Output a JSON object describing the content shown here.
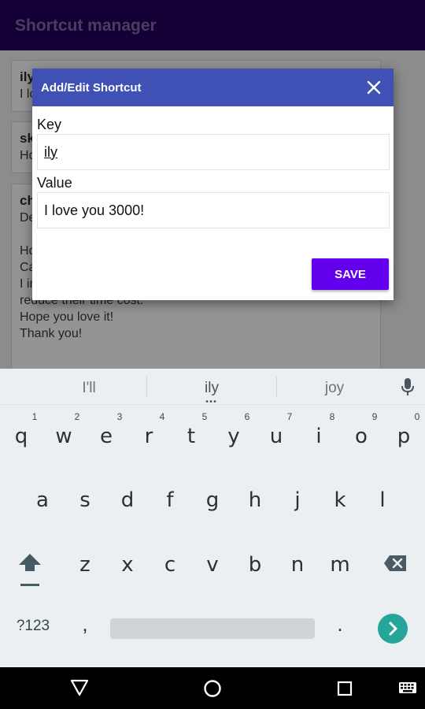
{
  "app": {
    "title": "Shortcut manager"
  },
  "background_cards": [
    {
      "title": "ily",
      "body": "I lo"
    },
    {
      "title": "sk",
      "body": "Ho"
    },
    {
      "title": "ch",
      "body": "De\n\nHo\nCa\nI intent to create an app ecosystem to make users\nreduce their time cost.\nHope you love it!\nThank you!"
    }
  ],
  "dialog": {
    "title": "Add/Edit Shortcut",
    "key_label": "Key",
    "key_value": "ily",
    "value_label": "Value",
    "value_value": "I love you 3000!",
    "save_label": "SAVE"
  },
  "keyboard": {
    "suggestions": [
      "I'll",
      "ily",
      "joy"
    ],
    "row1": [
      "q",
      "w",
      "e",
      "r",
      "t",
      "y",
      "u",
      "i",
      "o",
      "p"
    ],
    "row1_hints": [
      "1",
      "2",
      "3",
      "4",
      "5",
      "6",
      "7",
      "8",
      "9",
      "0"
    ],
    "row2": [
      "a",
      "s",
      "d",
      "f",
      "g",
      "h",
      "j",
      "k",
      "l"
    ],
    "row3": [
      "z",
      "x",
      "c",
      "v",
      "b",
      "n",
      "m"
    ],
    "symbols_label": "?123",
    "comma": ",",
    "period": "."
  },
  "colors": {
    "app_bar": "#24005e",
    "dialog_header": "#3f51b5",
    "save_button": "#6200ee",
    "enter_key": "#26a69a",
    "keyboard_bg": "#eceff1"
  },
  "icons": {
    "close": "close-icon",
    "mic": "mic-icon",
    "shift": "shift-icon",
    "backspace": "backspace-icon",
    "enter": "chevron-right-icon",
    "nav_back": "triangle-back-icon",
    "nav_home": "circle-home-icon",
    "nav_recent": "square-recent-icon",
    "nav_keyboard": "keyboard-icon"
  }
}
